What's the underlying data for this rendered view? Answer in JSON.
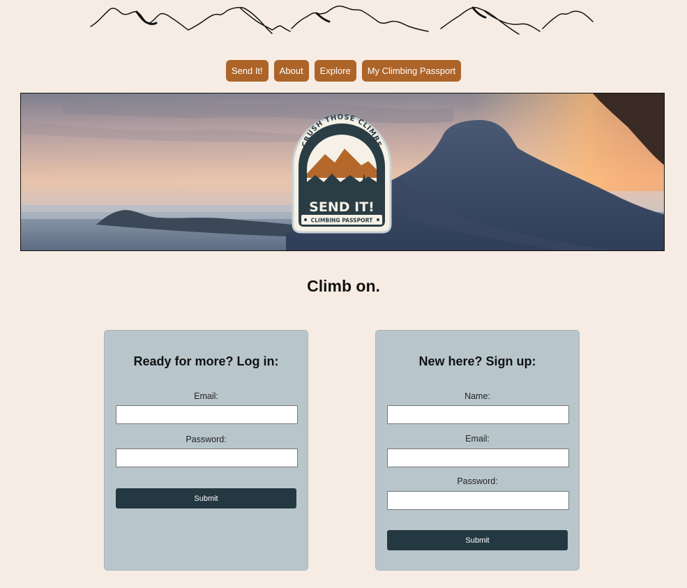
{
  "nav": {
    "items": [
      {
        "label": "Send It!"
      },
      {
        "label": "About"
      },
      {
        "label": "Explore"
      },
      {
        "label": "My Climbing Passport"
      }
    ]
  },
  "badge": {
    "arc_text": "CRUSH THOSE CLIMBS",
    "title": "SEND IT!",
    "subtitle": "CLIMBING PASSPORT"
  },
  "tagline": "Climb on.",
  "login": {
    "title": "Ready for more? Log in:",
    "email_label": "Email:",
    "password_label": "Password:",
    "email_value": "",
    "password_value": "",
    "submit_label": "Submit"
  },
  "signup": {
    "title": "New here? Sign up:",
    "name_label": "Name:",
    "email_label": "Email:",
    "password_label": "Password:",
    "name_value": "",
    "email_value": "",
    "password_value": "",
    "submit_label": "Submit"
  },
  "colors": {
    "background": "#f6ece4",
    "nav_button": "#ad6428",
    "card": "#b8c6cb",
    "submit_button": "#243841",
    "badge_dark": "#2a3d45",
    "badge_orange": "#b5682c"
  }
}
